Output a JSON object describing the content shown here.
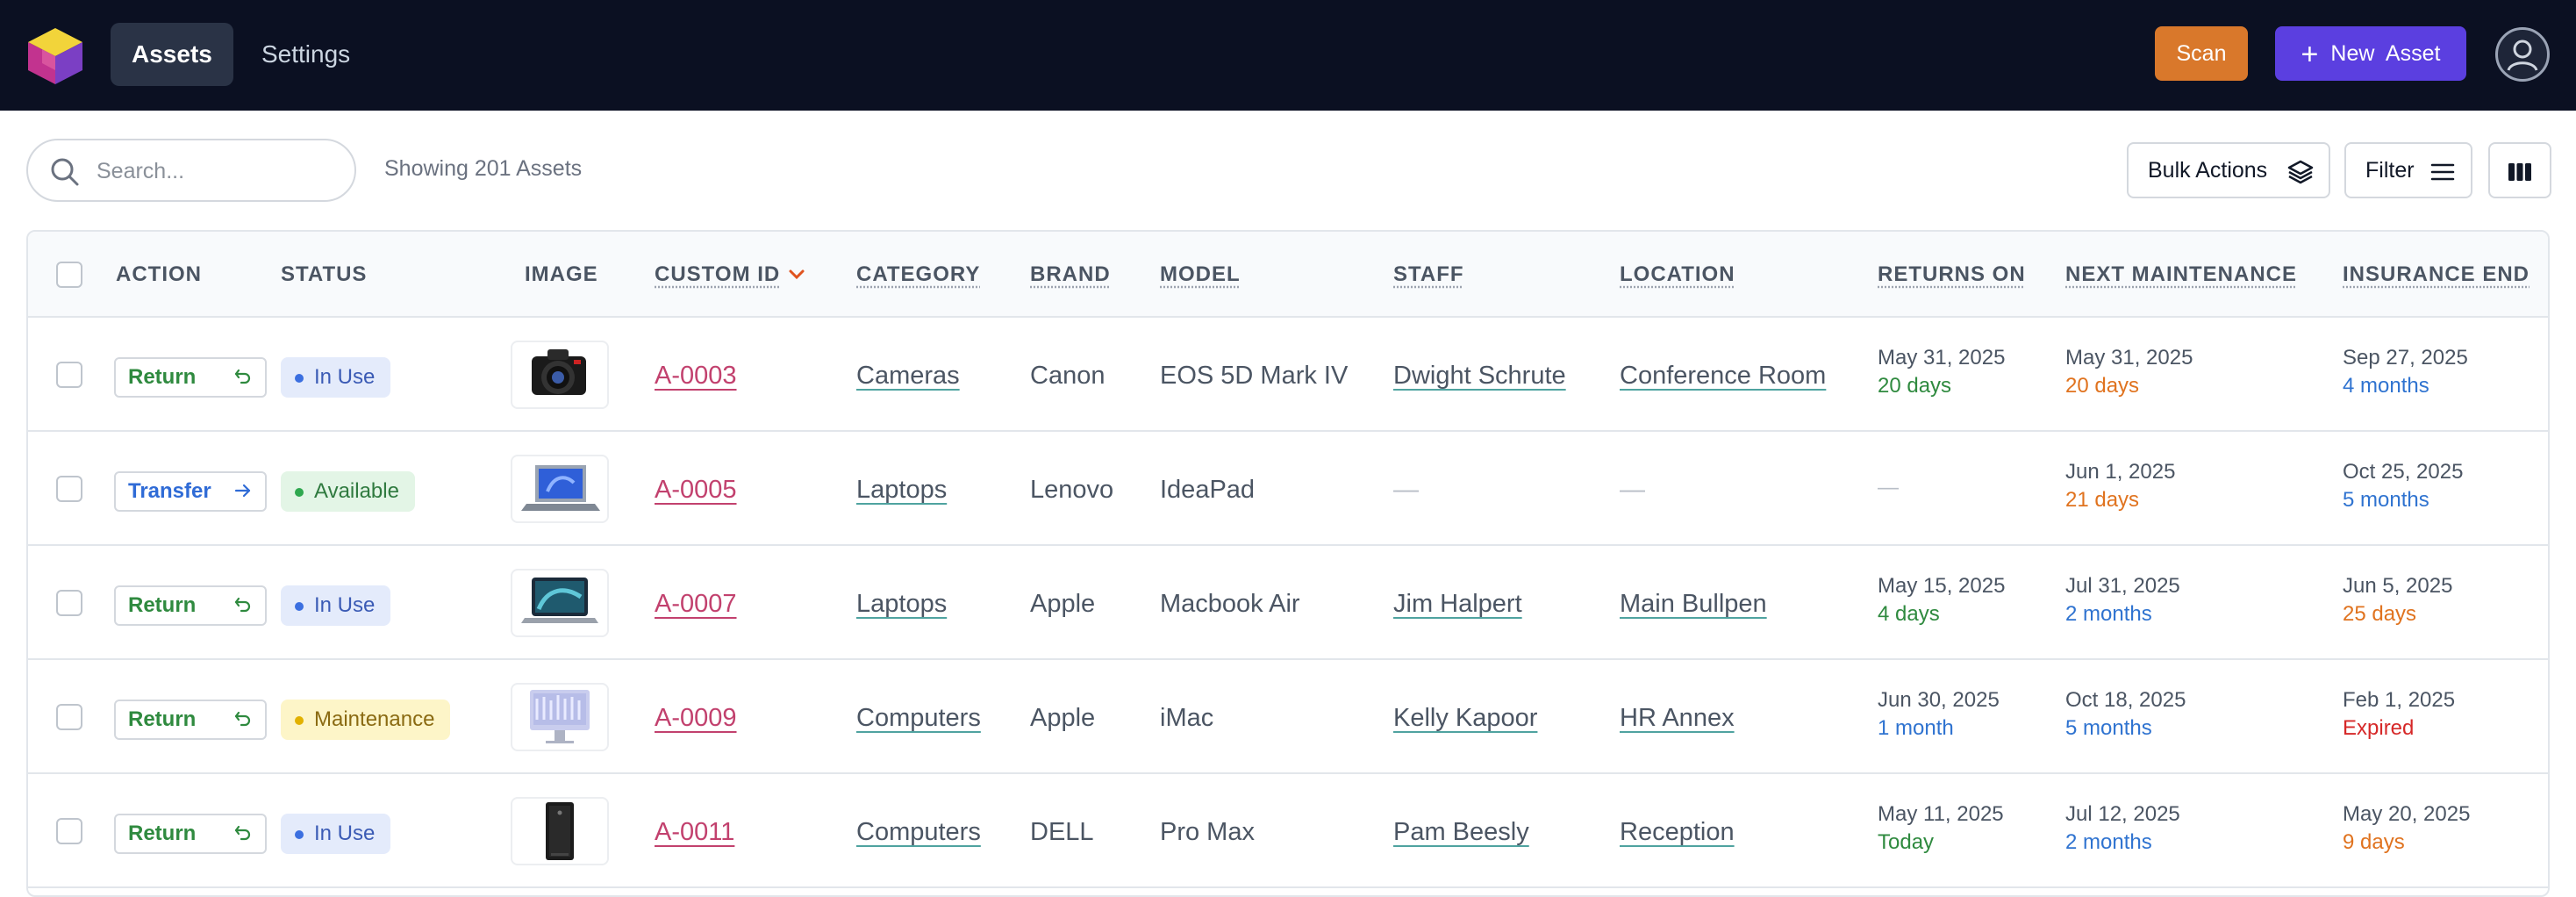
{
  "header": {
    "nav": [
      {
        "label": "Assets",
        "active": true
      },
      {
        "label": "Settings",
        "active": false
      }
    ],
    "scan_label": "Scan",
    "new_asset_label": "New  Asset"
  },
  "toolbar": {
    "search_placeholder": "Search...",
    "count_text": "Showing 201 Assets",
    "bulk_actions_label": "Bulk Actions",
    "filter_label": "Filter"
  },
  "columns": [
    "ACTION",
    "STATUS",
    "IMAGE",
    "CUSTOM ID",
    "CATEGORY",
    "BRAND",
    "MODEL",
    "STAFF",
    "LOCATION",
    "RETURNS ON",
    "NEXT MAINTENANCE",
    "INSURANCE END"
  ],
  "colors": {
    "in_use_bg": "#e4ebfb",
    "in_use_text": "#3b5bb5",
    "in_use_dot": "#3b6fe0",
    "available_bg": "#e3f5e6",
    "available_text": "#2f7a3f",
    "available_dot": "#2fa84f",
    "maintenance_bg": "#fdf5c8",
    "maintenance_text": "#8a6a12",
    "maintenance_dot": "#e2b100",
    "return_text": "#2f8a3f",
    "transfer_text": "#2f6bd6",
    "custom_id": "#c2416e",
    "green": "#2f8a3f",
    "orange": "#e0731f",
    "blue": "#2f73d0",
    "red": "#d62828",
    "dash": "#b8bec7"
  },
  "rows": [
    {
      "action": "Return",
      "action_icon": "return-icon",
      "status": "In Use",
      "status_key": "in_use",
      "image": "camera-icon",
      "custom_id": "A-0003",
      "category": "Cameras",
      "brand": "Canon",
      "model": "EOS 5D Mark IV",
      "staff": "Dwight Schrute",
      "location": "Conference Room",
      "returns_on": "May 31, 2025",
      "returns_rel": "20 days",
      "returns_color": "green",
      "maint": "May 31, 2025",
      "maint_rel": "20 days",
      "maint_color": "orange",
      "ins": "Sep 27, 2025",
      "ins_rel": "4 months",
      "ins_color": "blue"
    },
    {
      "action": "Transfer",
      "action_icon": "arrow-right-icon",
      "status": "Available",
      "status_key": "available",
      "image": "laptop-icon",
      "custom_id": "A-0005",
      "category": "Laptops",
      "brand": "Lenovo",
      "model": "IdeaPad",
      "staff": "—",
      "location": "—",
      "returns_on": "—",
      "returns_rel": "",
      "returns_color": "green",
      "maint": "Jun 1, 2025",
      "maint_rel": "21 days",
      "maint_color": "orange",
      "ins": "Oct 25, 2025",
      "ins_rel": "5 months",
      "ins_color": "blue"
    },
    {
      "action": "Return",
      "action_icon": "return-icon",
      "status": "In Use",
      "status_key": "in_use",
      "image": "macbook-icon",
      "custom_id": "A-0007",
      "category": "Laptops",
      "brand": "Apple",
      "model": "Macbook Air",
      "staff": "Jim Halpert",
      "location": "Main Bullpen",
      "returns_on": "May 15, 2025",
      "returns_rel": "4 days",
      "returns_color": "green",
      "maint": "Jul 31, 2025",
      "maint_rel": "2 months",
      "maint_color": "blue",
      "ins": "Jun 5, 2025",
      "ins_rel": "25 days",
      "ins_color": "orange"
    },
    {
      "action": "Return",
      "action_icon": "return-icon",
      "status": "Maintenance",
      "status_key": "maintenance",
      "image": "imac-icon",
      "custom_id": "A-0009",
      "category": "Computers",
      "brand": "Apple",
      "model": "iMac",
      "staff": "Kelly Kapoor",
      "location": "HR Annex",
      "returns_on": "Jun 30, 2025",
      "returns_rel": "1 month",
      "returns_color": "blue",
      "maint": "Oct 18, 2025",
      "maint_rel": "5 months",
      "maint_color": "blue",
      "ins": "Feb 1, 2025",
      "ins_rel": "Expired",
      "ins_color": "red"
    },
    {
      "action": "Return",
      "action_icon": "return-icon",
      "status": "In Use",
      "status_key": "in_use",
      "image": "desktop-tower-icon",
      "custom_id": "A-0011",
      "category": "Computers",
      "brand": "DELL",
      "model": "Pro Max",
      "staff": "Pam Beesly",
      "location": "Reception",
      "returns_on": "May 11, 2025",
      "returns_rel": "Today",
      "returns_color": "green",
      "maint": "Jul 12, 2025",
      "maint_rel": "2 months",
      "maint_color": "blue",
      "ins": "May 20, 2025",
      "ins_rel": "9 days",
      "ins_color": "orange"
    }
  ]
}
